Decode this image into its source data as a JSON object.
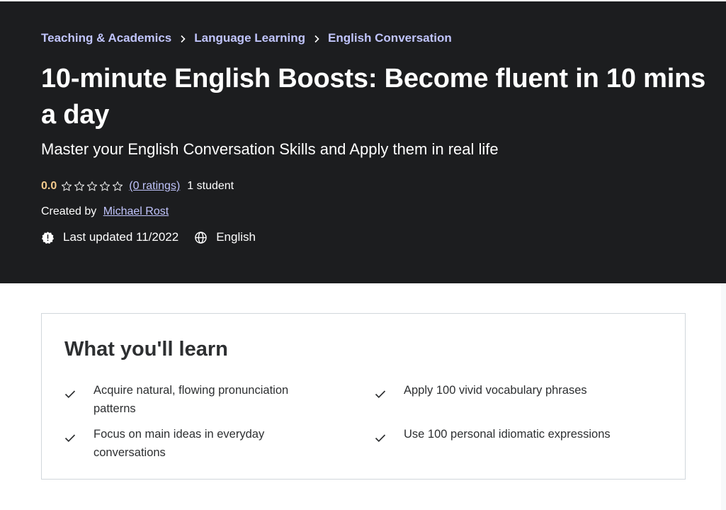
{
  "breadcrumb": [
    "Teaching & Academics",
    "Language Learning",
    "English Conversation"
  ],
  "course": {
    "title": "10-minute English Boosts: Become fluent in 10 mins a day",
    "subtitle": "Master your English Conversation Skills and Apply them in real life",
    "rating_value": "0.0",
    "rating_stars_filled": 0,
    "rating_stars_total": 5,
    "ratings_link": "(0 ratings)",
    "students": "1 student",
    "created_by_label": "Created by",
    "instructor": "Michael Rost",
    "last_updated": "Last updated 11/2022",
    "language": "English"
  },
  "learn": {
    "title": "What you'll learn",
    "items": [
      "Acquire natural, flowing pronunciation patterns",
      "Apply 100 vivid vocabulary phrases",
      "Focus on main ideas in everyday conversations",
      "Use 100 personal idiomatic expressions"
    ]
  },
  "colors": {
    "hero_background": "#1c1d1f",
    "link_purple": "#c0c4fc",
    "rating_gold": "#f3ca8c",
    "text_dark": "#2d2f31",
    "card_border": "#d1d7dc"
  },
  "icons": {
    "breadcrumb_separator": "chevron-right-icon",
    "star": "star-outline-icon",
    "last_updated": "alert-badge-icon",
    "language": "globe-icon",
    "learn_item": "check-icon"
  }
}
